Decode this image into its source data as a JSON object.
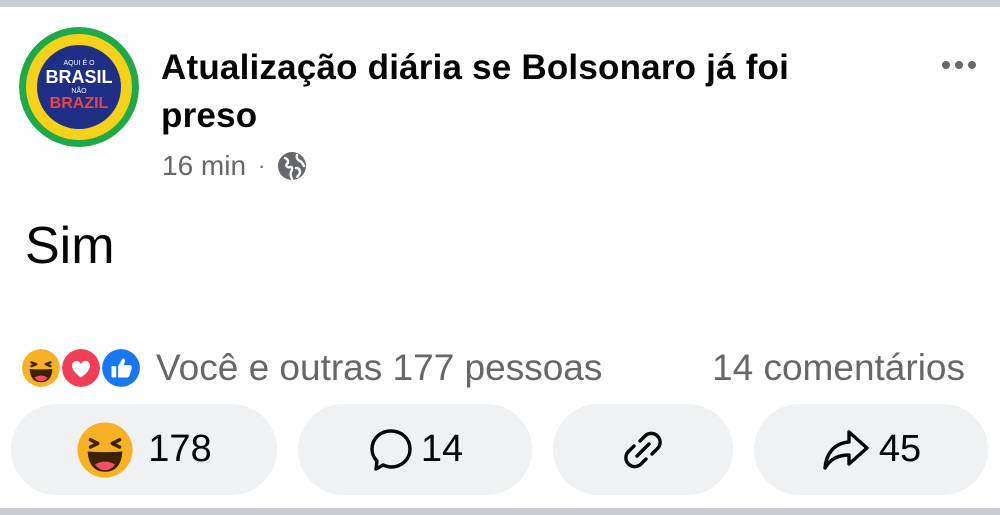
{
  "post": {
    "page_name": "Atualização diária se Bolsonaro já foi preso",
    "time": "16 min",
    "separator": "·",
    "privacy_icon": "globe-icon",
    "text": "Sim"
  },
  "avatar": {
    "top_text": "AQUI É O",
    "brasil": "BRASIL",
    "nao": "NÃO",
    "brazil": "BRAZIL",
    "colors": {
      "green": "#1fa94a",
      "yellow": "#f6d11a",
      "blue": "#1f2f86"
    }
  },
  "reactions": {
    "icons": [
      "haha-icon",
      "love-icon",
      "like-icon"
    ],
    "summary": "Você e outras 177 pessoas",
    "comments": "14 comentários"
  },
  "actions": {
    "react_count": "178",
    "comment_count": "14",
    "share_count": "45",
    "icons": {
      "react": "haha-icon",
      "comment": "comment-bubble-icon",
      "link": "link-icon",
      "share": "share-arrow-icon"
    }
  },
  "colors": {
    "text": "#050505",
    "secondary": "#65676b",
    "button_bg": "#eff1f3",
    "like_blue": "#1877f2",
    "love_red": "#f33e58",
    "haha_yellow": "#f7b125"
  }
}
